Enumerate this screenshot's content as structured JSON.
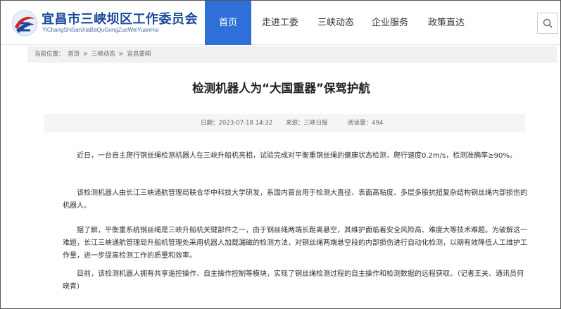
{
  "header": {
    "site_title": "宜昌市三峡坝区工作委员会",
    "site_subtitle": "YiChangShiSanXiaBaQuGongZuoWeiYuanHui",
    "brand_color": "#1a4a9c",
    "nav_active_color": "#2f6fd8",
    "nav": [
      {
        "label": "首页",
        "active": true
      },
      {
        "label": "走进工委",
        "active": false
      },
      {
        "label": "三峡动态",
        "active": false
      },
      {
        "label": "企业服务",
        "active": false
      },
      {
        "label": "政策直达",
        "active": false
      }
    ],
    "search_icon": "search-icon"
  },
  "breadcrumb": {
    "prefix": "当前位置：",
    "items": [
      "首页",
      ">",
      "三峡动态",
      ">",
      "宜昌要闻"
    ]
  },
  "article": {
    "title": "检测机器人为“大国重器”保驾护航",
    "meta": {
      "date": "日期：2023-07-18 14:32",
      "source": "来源：三峡日报",
      "views": "阅读量：494"
    },
    "paragraphs": [
      "近日，一台自主爬行钢丝绳检测机器人在三峡升船机亮相，试验完成对平衡重钢丝绳的健康状态检测，爬行速度0.2m/s，检测准确率≥90%。",
      "该检测机器人由长江三峡通航管理局联合华中科技大学研发，系国内首台用于检测大直径、表面高粘度、多层多股抗扭复杂结构钢丝绳内部损伤的机器人。",
      "据了解，平衡重系统钢丝绳是三峡升船机关键部件之一，由于钢丝绳两端长距离悬空，其维护面临着安全风险高、难度大等技术难题。为破解这一难题，长江三峡通航管理局升船机管理处采用机器人加载漏磁的检测方法，对钢丝绳两端悬空段的内部损伤进行自动化检测，以期有效降低人工维护工作量，进一步提高检测工作的质量和效率。",
      "目前，该检测机器人拥有共享遥控操作、自主操作控制等模块，实现了钢丝绳检测过程的自主操作和检测数据的远程获取。（记者王关、通讯员何晓青）"
    ]
  }
}
